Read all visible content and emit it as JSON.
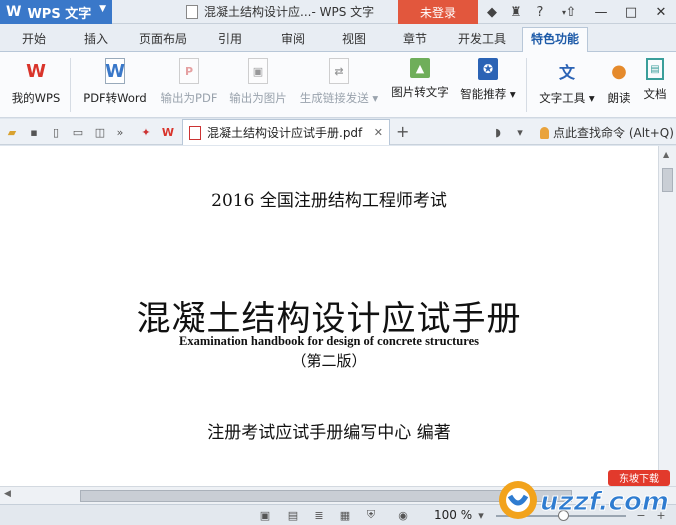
{
  "titlebar": {
    "app_button": "WPS 文字",
    "document_title": "混凝土结构设计应...- WPS 文字",
    "login_button": "未登录"
  },
  "tabs": [
    "开始",
    "插入",
    "页面布局",
    "引用",
    "审阅",
    "视图",
    "章节",
    "开发工具",
    "特色功能"
  ],
  "active_tab": "特色功能",
  "ribbon": {
    "my_wps": "我的WPS",
    "pdf_to_word": "PDF转Word",
    "export_pdf": "输出为PDF",
    "export_image": "输出为图片",
    "share_link": "生成链接发送",
    "image_to_text": "图片转文字",
    "smart_recommend": "智能推荐",
    "text_tools": "文字工具",
    "read_aloud": "朗读",
    "doc_compare": "文档"
  },
  "quickbar": {
    "document_tab": "混凝土结构设计应试手册.pdf",
    "command_search": "点此查找命令 (Alt+Q)"
  },
  "document": {
    "exam_line": "2016 全国注册结构工程师考试",
    "main_title": "混凝土结构设计应试手册",
    "english_title": "Examination handbook for design of concrete structures",
    "edition": "（第二版）",
    "author": "注册考试应试手册编写中心  编著"
  },
  "statusbar": {
    "zoom": "100 %"
  },
  "watermark": {
    "text": "uzzf.com",
    "badge": "东坡下载"
  },
  "colors": {
    "accent": "#3a78c9",
    "login": "#e2573d"
  }
}
